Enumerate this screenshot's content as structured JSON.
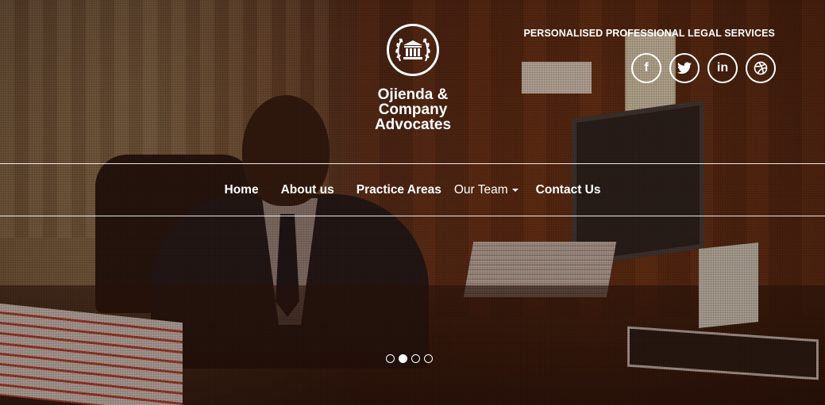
{
  "header": {
    "firm_name_line1": "Ojienda &",
    "firm_name_line2": "Company",
    "firm_name_line3": "Advocates",
    "tagline": "PERSONALISED PROFESSIONAL LEGAL SERVICES",
    "logo_icon": "courthouse-laurel-icon"
  },
  "socials": [
    {
      "icon": "facebook-icon",
      "glyph": "f"
    },
    {
      "icon": "twitter-icon",
      "glyph": "🐦"
    },
    {
      "icon": "linkedin-icon",
      "glyph": "in"
    },
    {
      "icon": "dribbble-icon",
      "glyph": "◎"
    }
  ],
  "nav": {
    "items": [
      {
        "label": "Home"
      },
      {
        "label": "About us"
      },
      {
        "label": "Practice Areas"
      },
      {
        "label": "Our Team"
      },
      {
        "label": "Contact Us"
      }
    ]
  },
  "slider": {
    "slide_count": 4,
    "active_index": 1
  },
  "colors": {
    "overlay": "#3c190c",
    "text": "#ffffff"
  }
}
